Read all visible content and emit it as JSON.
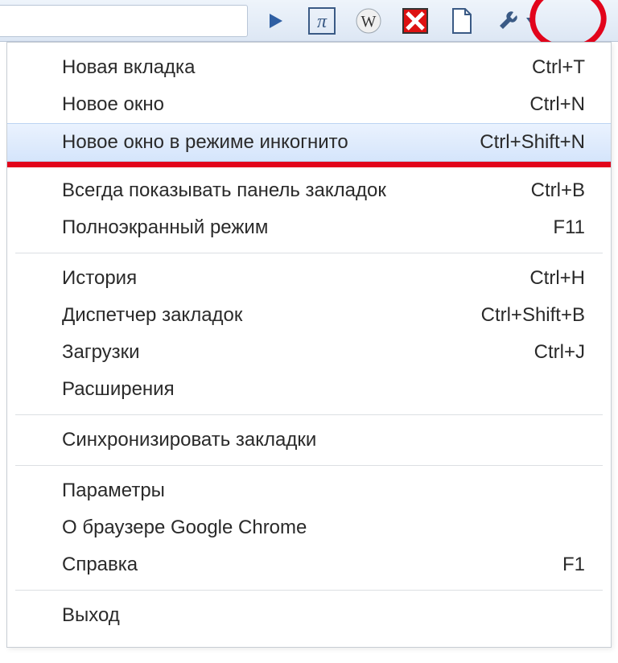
{
  "toolbar": {
    "icons": {
      "play": "play-icon",
      "pi": "pi-icon",
      "wiki": "wikipedia-icon",
      "xred": "red-x-icon",
      "page": "page-icon",
      "wrench": "wrench-icon"
    }
  },
  "menu": {
    "groups": [
      [
        {
          "label": "Новая вкладка",
          "shortcut": "Ctrl+T",
          "highlight": false,
          "red_underline_after": false
        },
        {
          "label": "Новое окно",
          "shortcut": "Ctrl+N",
          "highlight": false,
          "red_underline_after": false
        },
        {
          "label": "Новое окно в режиме инкогнито",
          "shortcut": "Ctrl+Shift+N",
          "highlight": true,
          "red_underline_after": true
        }
      ],
      [
        {
          "label": "Всегда показывать панель закладок",
          "shortcut": "Ctrl+B"
        },
        {
          "label": "Полноэкранный режим",
          "shortcut": "F11"
        }
      ],
      [
        {
          "label": "История",
          "shortcut": "Ctrl+H"
        },
        {
          "label": "Диспетчер закладок",
          "shortcut": "Ctrl+Shift+B"
        },
        {
          "label": "Загрузки",
          "shortcut": "Ctrl+J"
        },
        {
          "label": "Расширения",
          "shortcut": ""
        }
      ],
      [
        {
          "label": "Синхронизировать закладки",
          "shortcut": ""
        }
      ],
      [
        {
          "label": "Параметры",
          "shortcut": ""
        },
        {
          "label": "О браузере Google Chrome",
          "shortcut": ""
        },
        {
          "label": "Справка",
          "shortcut": "F1"
        }
      ],
      [
        {
          "label": "Выход",
          "shortcut": ""
        }
      ]
    ]
  },
  "colors": {
    "annotation_red": "#e2041b",
    "toolbar_bg_top": "#eef4fb",
    "toolbar_bg_bottom": "#dde7f4",
    "hover_top": "#eaf2fe",
    "hover_bottom": "#d5e5fb"
  }
}
